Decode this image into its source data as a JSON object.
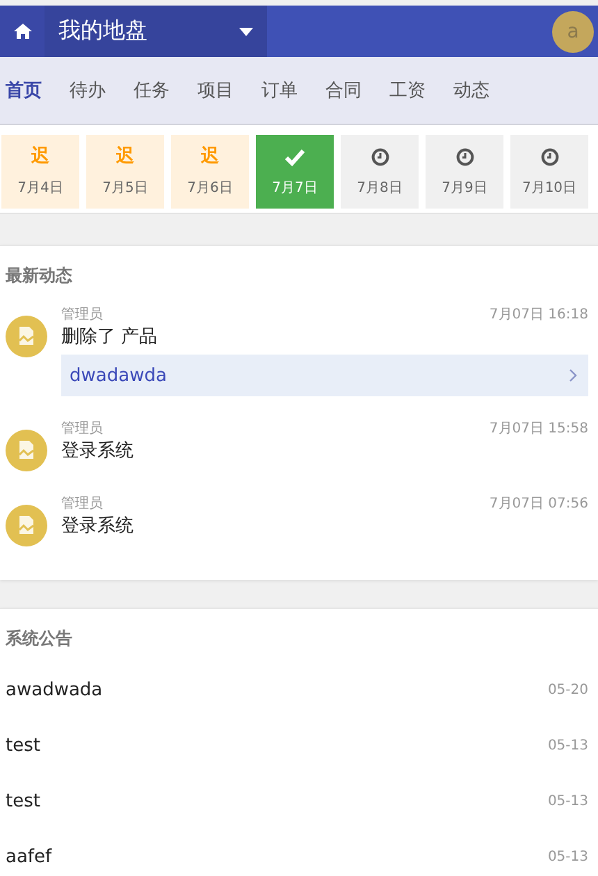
{
  "header": {
    "title": "我的地盘",
    "avatar": "a"
  },
  "nav": [
    {
      "label": "首页",
      "selected": true
    },
    {
      "label": "待办",
      "selected": false
    },
    {
      "label": "任务",
      "selected": false
    },
    {
      "label": "项目",
      "selected": false
    },
    {
      "label": "订单",
      "selected": false
    },
    {
      "label": "合同",
      "selected": false
    },
    {
      "label": "工资",
      "selected": false
    },
    {
      "label": "动态",
      "selected": false
    }
  ],
  "days": [
    {
      "kind": "late",
      "mark": "迟",
      "date": "7月4日"
    },
    {
      "kind": "late",
      "mark": "迟",
      "date": "7月5日"
    },
    {
      "kind": "late",
      "mark": "迟",
      "date": "7月6日"
    },
    {
      "kind": "done",
      "date": "7月7日"
    },
    {
      "kind": "pending",
      "date": "7月8日"
    },
    {
      "kind": "pending",
      "date": "7月9日"
    },
    {
      "kind": "pending",
      "date": "7月10日"
    }
  ],
  "activity": {
    "title": "最新动态",
    "items": [
      {
        "user": "管理员",
        "time": "7月07日 16:18",
        "action": "删除了 产品",
        "link": "dwadawda"
      },
      {
        "user": "管理员",
        "time": "7月07日 15:58",
        "action": "登录系统"
      },
      {
        "user": "管理员",
        "time": "7月07日 07:56",
        "action": "登录系统"
      }
    ]
  },
  "notices": {
    "title": "系统公告",
    "items": [
      {
        "title": "awadwada",
        "date": "05-20"
      },
      {
        "title": "test",
        "date": "05-13"
      },
      {
        "title": "test",
        "date": "05-13"
      },
      {
        "title": "aafef",
        "date": "05-13"
      }
    ]
  }
}
